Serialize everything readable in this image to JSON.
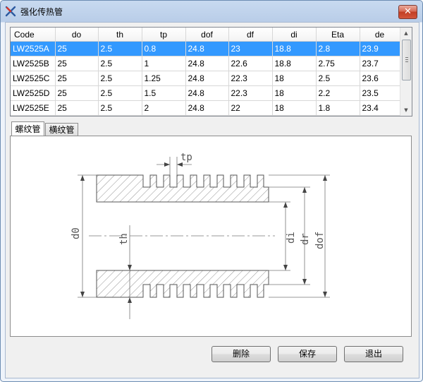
{
  "window": {
    "title": "强化传热管",
    "close_glyph": "✕",
    "app_icon": "x-app-icon"
  },
  "table": {
    "columns": [
      "Code",
      "do",
      "th",
      "tp",
      "dof",
      "df",
      "di",
      "Eta",
      "de"
    ],
    "rows": [
      [
        "LW2525A",
        "25",
        "2.5",
        "0.8",
        "24.8",
        "23",
        "18.8",
        "2.8",
        "23.9"
      ],
      [
        "LW2525B",
        "25",
        "2.5",
        "1",
        "24.8",
        "22.6",
        "18.8",
        "2.75",
        "23.7"
      ],
      [
        "LW2525C",
        "25",
        "2.5",
        "1.25",
        "24.8",
        "22.3",
        "18",
        "2.5",
        "23.6"
      ],
      [
        "LW2525D",
        "25",
        "2.5",
        "1.5",
        "24.8",
        "22.3",
        "18",
        "2.2",
        "23.5"
      ],
      [
        "LW2525E",
        "25",
        "2.5",
        "2",
        "24.8",
        "22",
        "18",
        "1.8",
        "23.4"
      ]
    ],
    "selected_row": 0
  },
  "tabs": [
    "螺纹管",
    "横纹管"
  ],
  "active_tab": 0,
  "diagram_labels": {
    "tp": "tp",
    "d0": "d0",
    "th": "th",
    "di": "di",
    "dr": "dr",
    "dof": "dof"
  },
  "buttons": {
    "delete": "删除",
    "save": "保存",
    "exit": "退出"
  },
  "colors": {
    "selection": "#3399ff",
    "close_button": "#c23e24"
  }
}
